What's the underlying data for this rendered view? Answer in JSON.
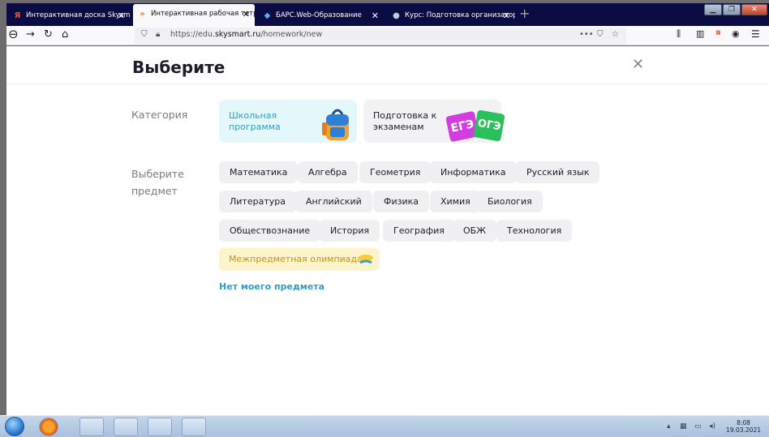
{
  "browser": {
    "tabs": [
      {
        "label": "Интерактивная доска Skysmart",
        "icon": "yandex-icon",
        "active": false
      },
      {
        "label": "Интерактивная рабочая тетрадь",
        "icon": "skysmart-icon",
        "active": true
      },
      {
        "label": "БАРС.Web-Образование",
        "icon": "bars-icon",
        "active": false
      },
      {
        "label": "Курс: Подготовка организатор",
        "icon": "moodle-icon",
        "active": false
      }
    ],
    "url_prefix": "https://edu.",
    "url_domain": "skysmart.ru",
    "url_path": "/homework/new"
  },
  "page": {
    "title": "Выберите",
    "category_label": "Категория",
    "categories": [
      {
        "label": "Школьная\nпрограмма",
        "line1": "Школьная",
        "line2": "программа"
      },
      {
        "label": "Подготовка к\nэкзаменам",
        "line1": "Подготовка к",
        "line2": "экзаменам",
        "badge1": "ЕГЭ",
        "badge2": "ОГЭ"
      }
    ],
    "subject_label_line1": "Выберите",
    "subject_label_line2": "предмет",
    "subjects": [
      [
        "Математика",
        "Алгебра",
        "Геометрия",
        "Информатика",
        "Русский язык"
      ],
      [
        "Литература",
        "Английский",
        "Физика",
        "Химия",
        "Биология"
      ],
      [
        "Обществознание",
        "История",
        "География",
        "ОБЖ",
        "Технология"
      ]
    ],
    "olympiad": "Межпредметная олимпиада",
    "no_subject_link": "Нет моего предмета"
  },
  "taskbar": {
    "time": "8:08",
    "date": "19.03.2021"
  },
  "colors": {
    "accent": "#2e9fc3",
    "chat": "#3ea3d6",
    "olympiad_bg": "#fdf4cc"
  }
}
